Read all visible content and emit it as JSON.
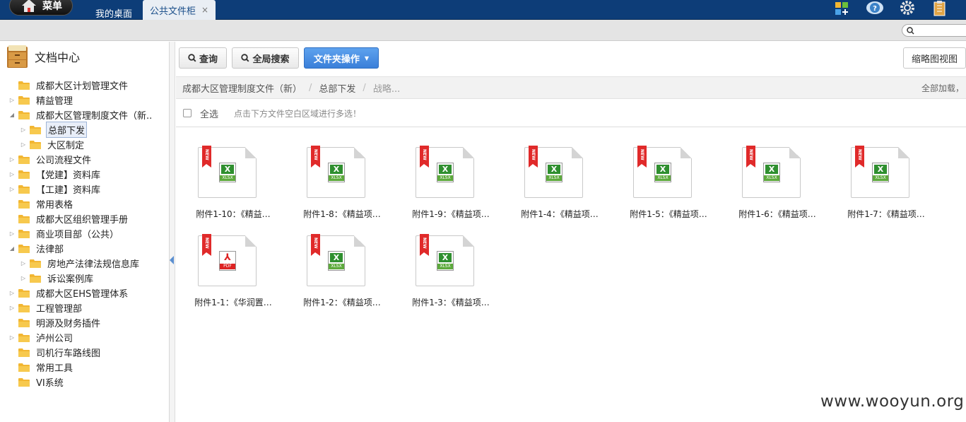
{
  "topbar": {
    "menu_label": "菜单",
    "tabs": [
      {
        "label": "我的桌面"
      },
      {
        "label": "公共文件柜",
        "close": "×"
      }
    ]
  },
  "sidebar": {
    "title": "文档中心",
    "items": [
      {
        "label": "成都大区计划管理文件",
        "toggle": ""
      },
      {
        "label": "精益管理",
        "toggle": "▷"
      },
      {
        "label": "成都大区管理制度文件（新..",
        "toggle": "◢"
      },
      {
        "label": "总部下发",
        "toggle": "▷"
      },
      {
        "label": "大区制定",
        "toggle": "▷"
      },
      {
        "label": "公司流程文件",
        "toggle": "▷"
      },
      {
        "label": "【党建】资料库",
        "toggle": "▷"
      },
      {
        "label": "【工建】资料库",
        "toggle": "▷"
      },
      {
        "label": "常用表格",
        "toggle": ""
      },
      {
        "label": "成都大区组织管理手册",
        "toggle": ""
      },
      {
        "label": "商业项目部（公共）",
        "toggle": "▷"
      },
      {
        "label": "法律部",
        "toggle": "◢"
      },
      {
        "label": "房地产法律法规信息库",
        "toggle": "▷"
      },
      {
        "label": "诉讼案例库",
        "toggle": "▷"
      },
      {
        "label": "成都大区EHS管理体系",
        "toggle": "▷"
      },
      {
        "label": "工程管理部",
        "toggle": "▷"
      },
      {
        "label": "明源及财务插件",
        "toggle": ""
      },
      {
        "label": "泸州公司",
        "toggle": "▷"
      },
      {
        "label": "司机行车路线图",
        "toggle": ""
      },
      {
        "label": "常用工具",
        "toggle": ""
      },
      {
        "label": "VI系统",
        "toggle": ""
      }
    ]
  },
  "toolbar": {
    "query": "查询",
    "global_search": "全局搜索",
    "folder_ops": "文件夹操作",
    "thumbnail_view": "缩略图视图"
  },
  "breadcrumb": {
    "items": [
      "成都大区管理制度文件（新）",
      "总部下发",
      "战略..."
    ],
    "sep": "/",
    "right": "全部加载，"
  },
  "selectbar": {
    "select_all": "全选",
    "hint": "点击下方文件空白区域进行多选！"
  },
  "files": [
    {
      "name": "附件1-10：《精益…",
      "ext": "XLSX",
      "ribbon": "NEW"
    },
    {
      "name": "附件1-8：《精益项…",
      "ext": "XLSX",
      "ribbon": "NEW"
    },
    {
      "name": "附件1-9：《精益项…",
      "ext": "XLSX",
      "ribbon": "NEW"
    },
    {
      "name": "附件1-4：《精益项…",
      "ext": "XLSX",
      "ribbon": "NEW"
    },
    {
      "name": "附件1-5：《精益项…",
      "ext": "XLSX",
      "ribbon": "NEW"
    },
    {
      "name": "附件1-6：《精益项…",
      "ext": "XLSX",
      "ribbon": "NEW"
    },
    {
      "name": "附件1-7：《精益项…",
      "ext": "XLSX",
      "ribbon": "NEW"
    },
    {
      "name": "附件1-1：《华润置…",
      "ext": "PDF",
      "ribbon": "NEW"
    },
    {
      "name": "附件1-2：《精益项…",
      "ext": "XLSX",
      "ribbon": "NEW"
    },
    {
      "name": "附件1-3：《精益项…",
      "ext": "XLSX",
      "ribbon": "NEW"
    }
  ],
  "watermark": "www.wooyun.org",
  "colors": {
    "topbar": "#0d3d78",
    "accent": "#3a7fd9",
    "folder": "#f2b632"
  }
}
